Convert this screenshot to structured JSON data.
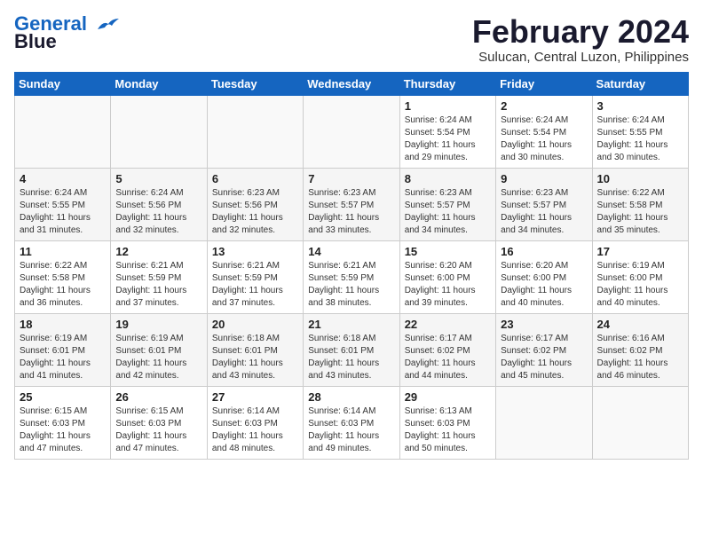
{
  "logo": {
    "line1": "General",
    "line2": "Blue"
  },
  "title": "February 2024",
  "location": "Sulucan, Central Luzon, Philippines",
  "days_header": [
    "Sunday",
    "Monday",
    "Tuesday",
    "Wednesday",
    "Thursday",
    "Friday",
    "Saturday"
  ],
  "weeks": [
    [
      {
        "day": "",
        "sunrise": "",
        "sunset": "",
        "daylight": ""
      },
      {
        "day": "",
        "sunrise": "",
        "sunset": "",
        "daylight": ""
      },
      {
        "day": "",
        "sunrise": "",
        "sunset": "",
        "daylight": ""
      },
      {
        "day": "",
        "sunrise": "",
        "sunset": "",
        "daylight": ""
      },
      {
        "day": "1",
        "sunrise": "Sunrise: 6:24 AM",
        "sunset": "Sunset: 5:54 PM",
        "daylight": "Daylight: 11 hours and 29 minutes."
      },
      {
        "day": "2",
        "sunrise": "Sunrise: 6:24 AM",
        "sunset": "Sunset: 5:54 PM",
        "daylight": "Daylight: 11 hours and 30 minutes."
      },
      {
        "day": "3",
        "sunrise": "Sunrise: 6:24 AM",
        "sunset": "Sunset: 5:55 PM",
        "daylight": "Daylight: 11 hours and 30 minutes."
      }
    ],
    [
      {
        "day": "4",
        "sunrise": "Sunrise: 6:24 AM",
        "sunset": "Sunset: 5:55 PM",
        "daylight": "Daylight: 11 hours and 31 minutes."
      },
      {
        "day": "5",
        "sunrise": "Sunrise: 6:24 AM",
        "sunset": "Sunset: 5:56 PM",
        "daylight": "Daylight: 11 hours and 32 minutes."
      },
      {
        "day": "6",
        "sunrise": "Sunrise: 6:23 AM",
        "sunset": "Sunset: 5:56 PM",
        "daylight": "Daylight: 11 hours and 32 minutes."
      },
      {
        "day": "7",
        "sunrise": "Sunrise: 6:23 AM",
        "sunset": "Sunset: 5:57 PM",
        "daylight": "Daylight: 11 hours and 33 minutes."
      },
      {
        "day": "8",
        "sunrise": "Sunrise: 6:23 AM",
        "sunset": "Sunset: 5:57 PM",
        "daylight": "Daylight: 11 hours and 34 minutes."
      },
      {
        "day": "9",
        "sunrise": "Sunrise: 6:23 AM",
        "sunset": "Sunset: 5:57 PM",
        "daylight": "Daylight: 11 hours and 34 minutes."
      },
      {
        "day": "10",
        "sunrise": "Sunrise: 6:22 AM",
        "sunset": "Sunset: 5:58 PM",
        "daylight": "Daylight: 11 hours and 35 minutes."
      }
    ],
    [
      {
        "day": "11",
        "sunrise": "Sunrise: 6:22 AM",
        "sunset": "Sunset: 5:58 PM",
        "daylight": "Daylight: 11 hours and 36 minutes."
      },
      {
        "day": "12",
        "sunrise": "Sunrise: 6:21 AM",
        "sunset": "Sunset: 5:59 PM",
        "daylight": "Daylight: 11 hours and 37 minutes."
      },
      {
        "day": "13",
        "sunrise": "Sunrise: 6:21 AM",
        "sunset": "Sunset: 5:59 PM",
        "daylight": "Daylight: 11 hours and 37 minutes."
      },
      {
        "day": "14",
        "sunrise": "Sunrise: 6:21 AM",
        "sunset": "Sunset: 5:59 PM",
        "daylight": "Daylight: 11 hours and 38 minutes."
      },
      {
        "day": "15",
        "sunrise": "Sunrise: 6:20 AM",
        "sunset": "Sunset: 6:00 PM",
        "daylight": "Daylight: 11 hours and 39 minutes."
      },
      {
        "day": "16",
        "sunrise": "Sunrise: 6:20 AM",
        "sunset": "Sunset: 6:00 PM",
        "daylight": "Daylight: 11 hours and 40 minutes."
      },
      {
        "day": "17",
        "sunrise": "Sunrise: 6:19 AM",
        "sunset": "Sunset: 6:00 PM",
        "daylight": "Daylight: 11 hours and 40 minutes."
      }
    ],
    [
      {
        "day": "18",
        "sunrise": "Sunrise: 6:19 AM",
        "sunset": "Sunset: 6:01 PM",
        "daylight": "Daylight: 11 hours and 41 minutes."
      },
      {
        "day": "19",
        "sunrise": "Sunrise: 6:19 AM",
        "sunset": "Sunset: 6:01 PM",
        "daylight": "Daylight: 11 hours and 42 minutes."
      },
      {
        "day": "20",
        "sunrise": "Sunrise: 6:18 AM",
        "sunset": "Sunset: 6:01 PM",
        "daylight": "Daylight: 11 hours and 43 minutes."
      },
      {
        "day": "21",
        "sunrise": "Sunrise: 6:18 AM",
        "sunset": "Sunset: 6:01 PM",
        "daylight": "Daylight: 11 hours and 43 minutes."
      },
      {
        "day": "22",
        "sunrise": "Sunrise: 6:17 AM",
        "sunset": "Sunset: 6:02 PM",
        "daylight": "Daylight: 11 hours and 44 minutes."
      },
      {
        "day": "23",
        "sunrise": "Sunrise: 6:17 AM",
        "sunset": "Sunset: 6:02 PM",
        "daylight": "Daylight: 11 hours and 45 minutes."
      },
      {
        "day": "24",
        "sunrise": "Sunrise: 6:16 AM",
        "sunset": "Sunset: 6:02 PM",
        "daylight": "Daylight: 11 hours and 46 minutes."
      }
    ],
    [
      {
        "day": "25",
        "sunrise": "Sunrise: 6:15 AM",
        "sunset": "Sunset: 6:03 PM",
        "daylight": "Daylight: 11 hours and 47 minutes."
      },
      {
        "day": "26",
        "sunrise": "Sunrise: 6:15 AM",
        "sunset": "Sunset: 6:03 PM",
        "daylight": "Daylight: 11 hours and 47 minutes."
      },
      {
        "day": "27",
        "sunrise": "Sunrise: 6:14 AM",
        "sunset": "Sunset: 6:03 PM",
        "daylight": "Daylight: 11 hours and 48 minutes."
      },
      {
        "day": "28",
        "sunrise": "Sunrise: 6:14 AM",
        "sunset": "Sunset: 6:03 PM",
        "daylight": "Daylight: 11 hours and 49 minutes."
      },
      {
        "day": "29",
        "sunrise": "Sunrise: 6:13 AM",
        "sunset": "Sunset: 6:03 PM",
        "daylight": "Daylight: 11 hours and 50 minutes."
      },
      {
        "day": "",
        "sunrise": "",
        "sunset": "",
        "daylight": ""
      },
      {
        "day": "",
        "sunrise": "",
        "sunset": "",
        "daylight": ""
      }
    ]
  ]
}
